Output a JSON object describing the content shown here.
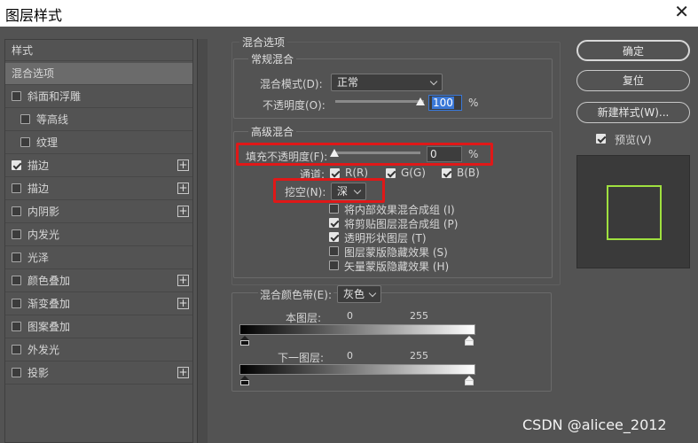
{
  "window": {
    "title": "图层样式"
  },
  "left_panel": {
    "header": "样式",
    "items": [
      {
        "label": "混合选项",
        "checkbox": null,
        "checked": false,
        "plus": false,
        "selected": true
      },
      {
        "label": "斜面和浮雕",
        "checkbox": true,
        "checked": false,
        "plus": false,
        "selected": false
      },
      {
        "label": "等高线",
        "checkbox": true,
        "checked": false,
        "plus": false,
        "selected": false,
        "indent": true
      },
      {
        "label": "纹理",
        "checkbox": true,
        "checked": false,
        "plus": false,
        "selected": false,
        "indent": true
      },
      {
        "label": "描边",
        "checkbox": true,
        "checked": true,
        "plus": true,
        "selected": false
      },
      {
        "label": "描边",
        "checkbox": true,
        "checked": false,
        "plus": true,
        "selected": false
      },
      {
        "label": "内阴影",
        "checkbox": true,
        "checked": false,
        "plus": true,
        "selected": false
      },
      {
        "label": "内发光",
        "checkbox": true,
        "checked": false,
        "plus": false,
        "selected": false
      },
      {
        "label": "光泽",
        "checkbox": true,
        "checked": false,
        "plus": false,
        "selected": false
      },
      {
        "label": "颜色叠加",
        "checkbox": true,
        "checked": false,
        "plus": true,
        "selected": false
      },
      {
        "label": "渐变叠加",
        "checkbox": true,
        "checked": false,
        "plus": true,
        "selected": false
      },
      {
        "label": "图案叠加",
        "checkbox": true,
        "checked": false,
        "plus": false,
        "selected": false
      },
      {
        "label": "外发光",
        "checkbox": true,
        "checked": false,
        "plus": false,
        "selected": false
      },
      {
        "label": "投影",
        "checkbox": true,
        "checked": false,
        "plus": true,
        "selected": false
      }
    ]
  },
  "blend_options": {
    "title": "混合选项",
    "general": {
      "title": "常规混合",
      "mode_label": "混合模式(D):",
      "mode_value": "正常",
      "opacity_label": "不透明度(O):",
      "opacity_value": "100",
      "percent": "%"
    },
    "advanced": {
      "title": "高级混合",
      "fill_label": "填充不透明度(F):",
      "fill_value": "0",
      "percent": "%",
      "channels_label": "通道:",
      "channels": [
        {
          "label": "R(R)",
          "checked": true
        },
        {
          "label": "G(G)",
          "checked": true
        },
        {
          "label": "B(B)",
          "checked": true
        }
      ],
      "knockout_label": "挖空(N):",
      "knockout_value": "深",
      "options": [
        {
          "label": "将内部效果混合成组 (I)",
          "checked": false
        },
        {
          "label": "将剪贴图层混合成组 (P)",
          "checked": true
        },
        {
          "label": "透明形状图层 (T)",
          "checked": true
        },
        {
          "label": "图层蒙版隐藏效果 (S)",
          "checked": false
        },
        {
          "label": "矢量蒙版隐藏效果 (H)",
          "checked": false
        }
      ]
    },
    "blend_if": {
      "label": "混合颜色带(E):",
      "value": "灰色",
      "this_layer": {
        "label": "本图层:",
        "min": "0",
        "max": "255"
      },
      "underlying": {
        "label": "下一图层:",
        "min": "0",
        "max": "255"
      }
    }
  },
  "buttons": {
    "ok": "确定",
    "reset": "复位",
    "new_style": "新建样式(W)...",
    "preview_label": "预览(V)",
    "preview_checked": true
  },
  "watermark": "CSDN @alicee_2012",
  "colors": {
    "highlight": "#e01818",
    "preview_stroke": "#9fe03f",
    "focus": "#3a78d8"
  }
}
